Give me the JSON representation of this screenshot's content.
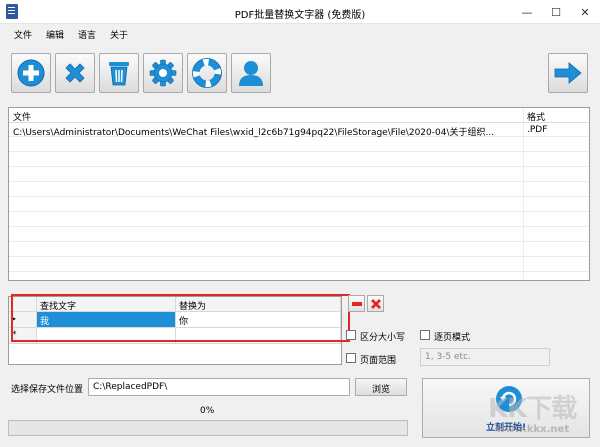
{
  "window": {
    "title": "PDF批量替换文字器 (免费版)",
    "minimize": "—",
    "maximize": "☐",
    "close": "✕"
  },
  "menu": [
    "文件",
    "编辑",
    "语言",
    "关于"
  ],
  "toolbar": {
    "buttons": [
      {
        "name": "add-icon",
        "color": "#1e8fd6"
      },
      {
        "name": "remove-icon",
        "color": "#1e8fd6"
      },
      {
        "name": "trash-icon",
        "color": "#1e8fd6"
      },
      {
        "name": "gear-icon",
        "color": "#1e8fd6"
      },
      {
        "name": "lifebuoy-icon",
        "color": "#1e8fd6"
      },
      {
        "name": "user-icon",
        "color": "#1e8fd6"
      }
    ],
    "next": {
      "name": "arrow-right-icon",
      "color": "#1e8fd6"
    }
  },
  "file_list": {
    "columns": [
      "文件",
      "格式"
    ],
    "rows": [
      {
        "file": "C:\\Users\\Administrator\\Documents\\WeChat Files\\wxid_l2c6b71g94pq22\\FileStorage\\File\\2020-04\\关于组织...",
        "format": ".PDF"
      }
    ]
  },
  "replace_grid": {
    "columns": [
      "查找文字",
      "替换为"
    ],
    "rows": [
      {
        "find": "我",
        "replace": "你"
      }
    ],
    "new_row_marker": "*",
    "current_row_marker": "▸"
  },
  "options": {
    "case_sensitive": "区分大小写",
    "page_mode": "逐页模式",
    "page_range": "页面范围",
    "page_range_placeholder": "1, 3-5 etc."
  },
  "output": {
    "label": "选择保存文件位置",
    "path": "C:\\ReplacedPDF\\",
    "browse": "浏览"
  },
  "progress": {
    "text": "0%",
    "value": 0
  },
  "start": {
    "label": "立刻开始!"
  },
  "watermark": {
    "text": "KK下载",
    "url": "www.kkx.net"
  },
  "colors": {
    "accent": "#1e8fd6",
    "highlight": "#1e8fd6",
    "red": "#e32727"
  }
}
